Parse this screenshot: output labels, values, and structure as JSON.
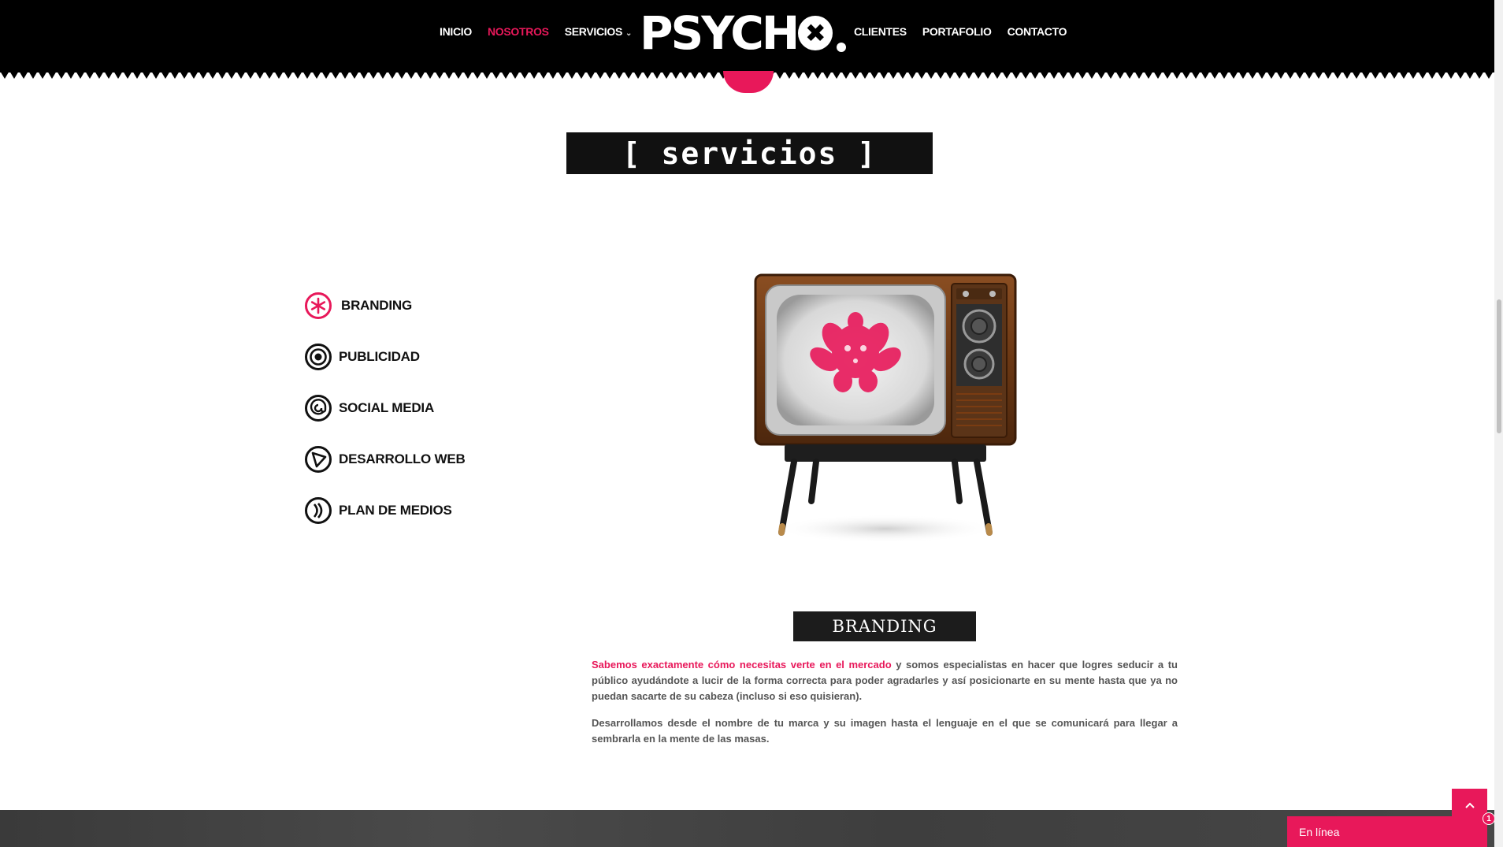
{
  "nav": {
    "left": [
      {
        "label": "INICIO"
      },
      {
        "label": "NOSOTROS"
      },
      {
        "label": "SERVICIOS"
      }
    ],
    "right": [
      {
        "label": "CLIENTES"
      },
      {
        "label": "PORTAFOLIO"
      },
      {
        "label": "CONTACTO"
      }
    ],
    "dropdown_icon": "chevron-down-icon"
  },
  "logo": {
    "text_before": "PSYCH",
    "x_mark": "✖"
  },
  "section_title": "[ servicios ]",
  "services": [
    {
      "label": "BRANDING",
      "icon": "asterisk-icon"
    },
    {
      "label": "PUBLICIDAD",
      "icon": "target-icon"
    },
    {
      "label": "SOCIAL MEDIA",
      "icon": "at-sign-icon"
    },
    {
      "label": "DESARROLLO WEB",
      "icon": "play-icon"
    },
    {
      "label": "PLAN DE MEDIOS",
      "icon": "broadcast-icon"
    }
  ],
  "branding": {
    "title": "BRANDING",
    "p1_highlight": "Sabemos exactamente cómo necesitas verte en el mercado",
    "p1_rest": " y somos especialistas en hacer que logres seducir a tu público ayudándote a lucir de la forma correcta para poder agradarles y así posicionarte en su mente hasta que ya no puedan sacarte de su cabeza (incluso si eso quisieran).",
    "p2": "Desarrollamos desde el nombre de tu marca y su imagen hasta el lenguaje en el que se comunicará para llegar a sembrarla en la mente de las masas."
  },
  "chat": {
    "label": "En línea",
    "badge": "1"
  },
  "back_to_top_icon": "chevron-up-icon",
  "colors": {
    "accent": "#e8185a",
    "header_bg": "#000000",
    "title_bg": "#111111"
  }
}
